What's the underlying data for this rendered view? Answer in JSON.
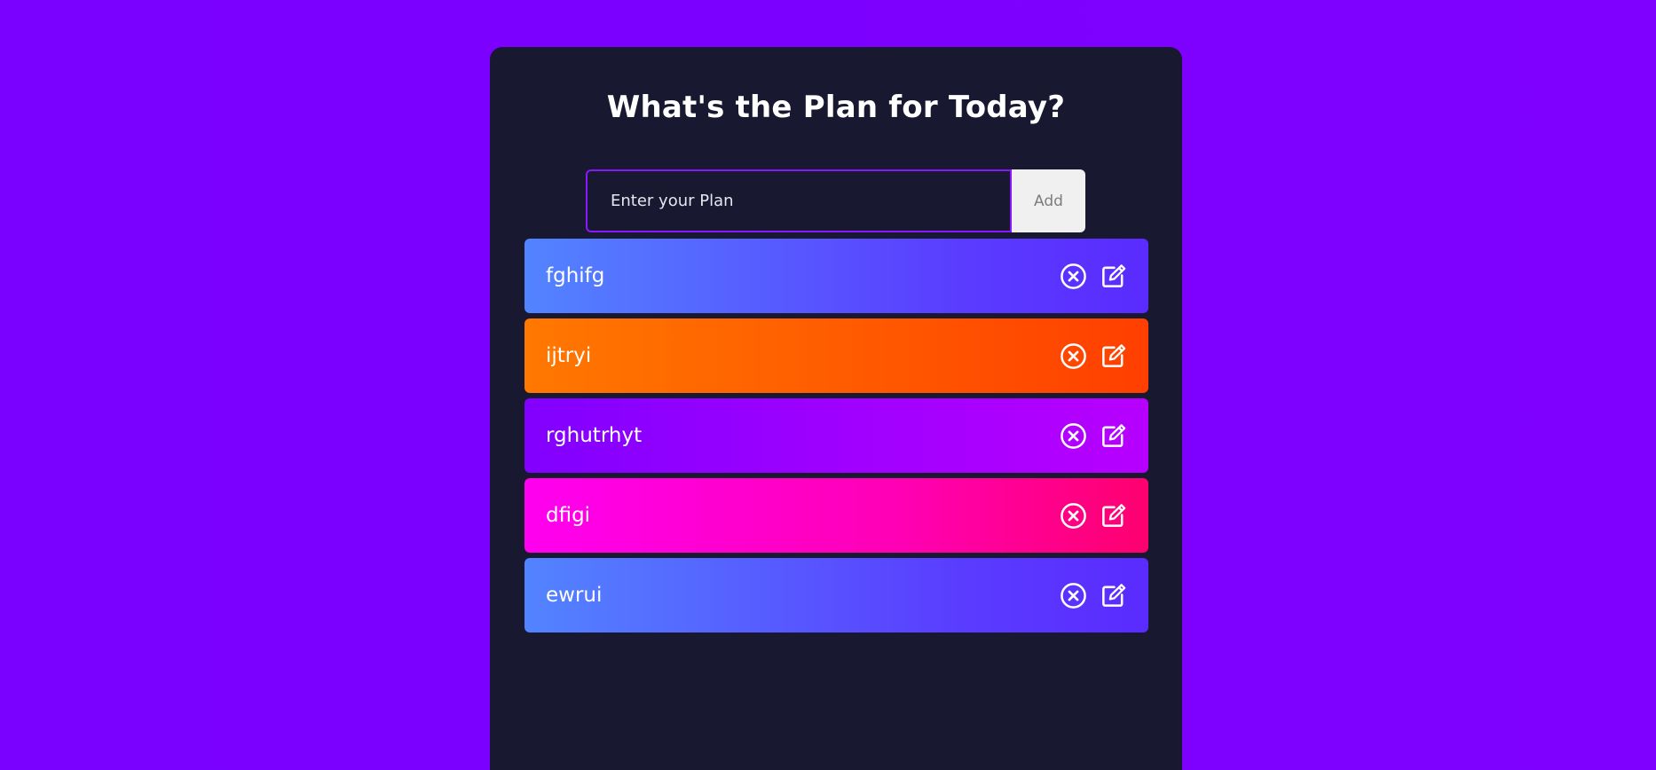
{
  "header": {
    "title": "What's the Plan for Today?"
  },
  "form": {
    "input_placeholder": "Enter your Plan",
    "add_label": "Add"
  },
  "todos": [
    {
      "text": "fghifg",
      "color_start": "#5284ff",
      "color_end": "#5a2bff"
    },
    {
      "text": "ijtryi",
      "color_start": "#ff7800",
      "color_end": "#ff3f00"
    },
    {
      "text": "rghutrhyt",
      "color_start": "#8200ff",
      "color_end": "#b700ff"
    },
    {
      "text": "dfigi",
      "color_start": "#ff00f0",
      "color_end": "#ff006f"
    },
    {
      "text": "ewrui",
      "color_start": "#5284ff",
      "color_end": "#5a2bff"
    }
  ],
  "icons": {
    "delete": "close-circle-icon",
    "edit": "edit-icon"
  },
  "colors": {
    "background": "#7f00ff",
    "panel": "#181830",
    "input_border": "#8a18ff"
  }
}
